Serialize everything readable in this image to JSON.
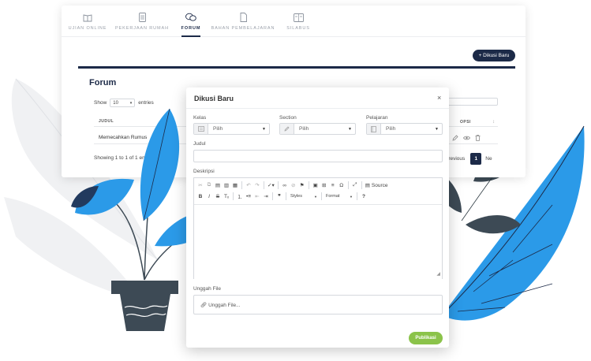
{
  "nav": {
    "tabs": [
      {
        "label": "UJIAN ONLINE",
        "icon": "book-icon"
      },
      {
        "label": "PEKERJAAN RUMAH",
        "icon": "document-icon"
      },
      {
        "label": "FORUM",
        "icon": "chat-icon",
        "active": true
      },
      {
        "label": "BAHAN PEMBELAJARAN",
        "icon": "file-icon"
      },
      {
        "label": "SILABUS",
        "icon": "syllabus-icon"
      }
    ]
  },
  "page": {
    "new_button": "+ Dikusi Baru",
    "title": "Forum",
    "show_label": "Show",
    "entries_value": "10",
    "entries_label": "entries",
    "table": {
      "headers": [
        "JUDUL",
        "OPSI"
      ],
      "rows": [
        {
          "judul": "Memecahkan Rumus"
        }
      ]
    },
    "showing": "Showing 1 to 1 of 1 entries",
    "pager": {
      "prev": "Previous",
      "current": "1",
      "next": "Ne"
    }
  },
  "modal": {
    "title": "Dikusi Baru",
    "close": "×",
    "kelas_label": "Kelas",
    "kelas_value": "Pilih",
    "section_label": "Section",
    "section_value": "Pilih",
    "pelajaran_label": "Pelajaran",
    "pelajaran_value": "Pilih",
    "judul_label": "Judul",
    "deskripsi_label": "Deskripsi",
    "toolbar": {
      "source": "Source",
      "styles": "Styles",
      "format": "Format"
    },
    "unggah_label": "Unggah File",
    "unggah_placeholder": "Unggah File...",
    "publish": "Publikasi"
  },
  "colors": {
    "navy": "#1c2a48",
    "leaf_blue": "#2b9ae8",
    "leaf_dark": "#223a5e",
    "publish_green": "#8bc34a"
  }
}
